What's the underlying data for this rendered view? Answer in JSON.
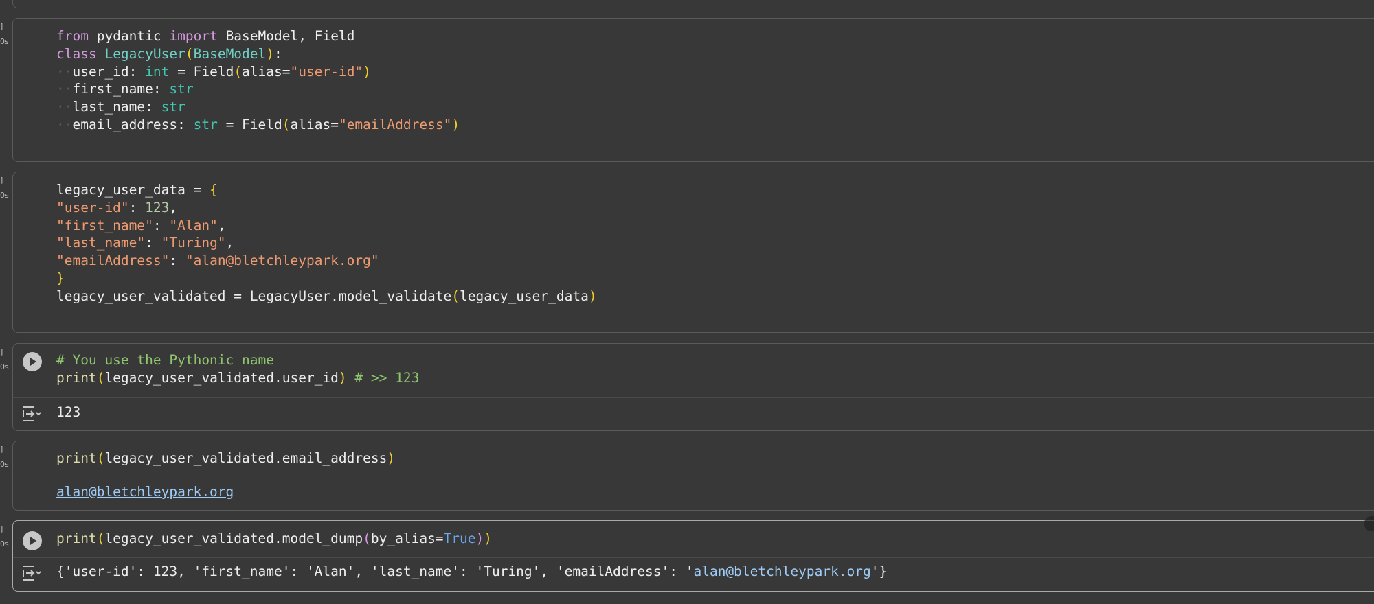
{
  "gutter": {
    "bracket": "]",
    "status": "0s"
  },
  "cells": [
    {
      "lines": [
        [
          [
            "kw",
            "from"
          ],
          [
            "id",
            " pydantic "
          ],
          [
            "kw",
            "import"
          ],
          [
            "id",
            " BaseModel, Field"
          ]
        ],
        [
          [
            "kw",
            "class"
          ],
          [
            "id",
            " "
          ],
          [
            "cls",
            "LegacyUser"
          ],
          [
            "par",
            "("
          ],
          [
            "cls",
            "BaseModel"
          ],
          [
            "par",
            ")"
          ],
          [
            "id",
            ":"
          ]
        ],
        [
          [
            "dot",
            "··"
          ],
          [
            "id",
            "user_id: "
          ],
          [
            "ty",
            "int"
          ],
          [
            "id",
            " = Field"
          ],
          [
            "par",
            "("
          ],
          [
            "id",
            "alias="
          ],
          [
            "str",
            "\"user-id\""
          ],
          [
            "par",
            ")"
          ]
        ],
        [
          [
            "dot",
            "··"
          ],
          [
            "id",
            "first_name: "
          ],
          [
            "ty",
            "str"
          ]
        ],
        [
          [
            "dot",
            "··"
          ],
          [
            "id",
            "last_name: "
          ],
          [
            "ty",
            "str"
          ]
        ],
        [
          [
            "dot",
            "··"
          ],
          [
            "id",
            "email_address: "
          ],
          [
            "ty",
            "str"
          ],
          [
            "id",
            " = Field"
          ],
          [
            "par",
            "("
          ],
          [
            "id",
            "alias="
          ],
          [
            "str",
            "\"emailAddress\""
          ],
          [
            "par",
            ")"
          ]
        ]
      ]
    },
    {
      "lines": [
        [
          [
            "id",
            "legacy_user_data = "
          ],
          [
            "par",
            "{"
          ]
        ],
        [
          [
            "str",
            "\"user-id\""
          ],
          [
            "id",
            ": "
          ],
          [
            "num",
            "123"
          ],
          [
            "id",
            ","
          ]
        ],
        [
          [
            "str",
            "\"first_name\""
          ],
          [
            "id",
            ": "
          ],
          [
            "str",
            "\"Alan\""
          ],
          [
            "id",
            ","
          ]
        ],
        [
          [
            "str",
            "\"last_name\""
          ],
          [
            "id",
            ": "
          ],
          [
            "str",
            "\"Turing\""
          ],
          [
            "id",
            ","
          ]
        ],
        [
          [
            "str",
            "\"emailAddress\""
          ],
          [
            "id",
            ": "
          ],
          [
            "str",
            "\"alan@bletchleypark.org\""
          ]
        ],
        [
          [
            "par",
            "}"
          ]
        ],
        [
          [
            "id",
            "legacy_user_validated = LegacyUser.model_validate"
          ],
          [
            "par",
            "("
          ],
          [
            "id",
            "legacy_user_data"
          ],
          [
            "par",
            ")"
          ]
        ]
      ]
    },
    {
      "lines": [
        [
          [
            "com",
            "# You use the Pythonic name"
          ]
        ],
        [
          [
            "fn",
            "print"
          ],
          [
            "par",
            "("
          ],
          [
            "id",
            "legacy_user_validated.user_id"
          ],
          [
            "par",
            ")"
          ],
          [
            "id",
            " "
          ],
          [
            "com",
            "# >> 123"
          ]
        ]
      ],
      "output": [
        [
          "id",
          "123"
        ]
      ]
    },
    {
      "lines": [
        [
          [
            "fn",
            "print"
          ],
          [
            "par",
            "("
          ],
          [
            "id",
            "legacy_user_validated.email_address"
          ],
          [
            "par",
            ")"
          ]
        ]
      ],
      "output": [
        [
          "link",
          "alan@bletchleypark.org"
        ]
      ]
    },
    {
      "lines": [
        [
          [
            "fn",
            "print"
          ],
          [
            "par",
            "("
          ],
          [
            "id",
            "legacy_user_validated.model_dump"
          ],
          [
            "par2",
            "("
          ],
          [
            "id",
            "by_alias="
          ],
          [
            "bool",
            "True"
          ],
          [
            "par2",
            ")"
          ],
          [
            "par",
            ")"
          ]
        ]
      ],
      "output": [
        [
          "id",
          "{'user-id': 123, 'first_name': 'Alan', 'last_name': 'Turing', 'emailAddress': '"
        ],
        [
          "link",
          "alan@bletchleypark.org"
        ],
        [
          "id",
          "'}"
        ]
      ]
    }
  ],
  "icons": {
    "run": "play-circle-icon",
    "output": "output-toggle-icon"
  }
}
